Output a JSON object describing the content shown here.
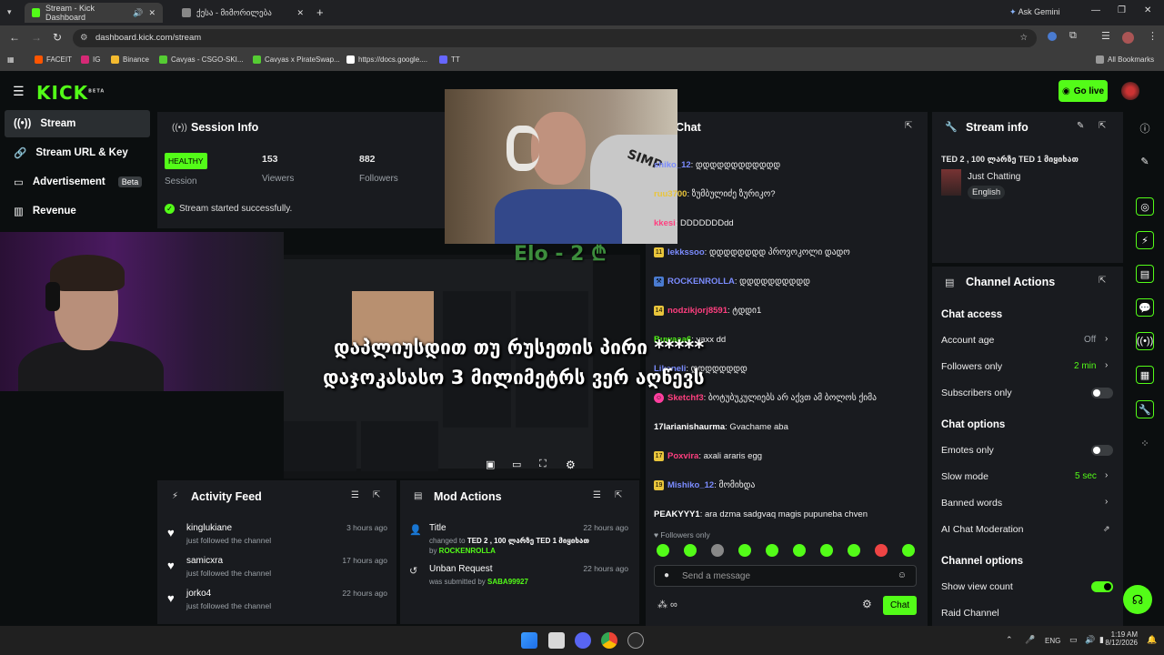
{
  "browser": {
    "tabs": [
      {
        "title": "Stream - Kick Dashboard",
        "active": true
      },
      {
        "title": "ქესა - მიმორილება",
        "active": false
      }
    ],
    "ask_gemini": "Ask Gemini",
    "url": "dashboard.kick.com/stream",
    "bookmarks": [
      "FACEIT",
      "IG",
      "Binance",
      "Cavyas - CSGO-SKI...",
      "Cavyas x PirateSwap...",
      "https://docs.google....",
      "TT"
    ],
    "all_bookmarks": "All Bookmarks"
  },
  "app": {
    "logo": "KICK",
    "logo_beta": "BETA",
    "go_live": "Go live",
    "sidebar": [
      {
        "label": "Stream",
        "icon": "broadcast-icon",
        "active": true
      },
      {
        "label": "Stream URL & Key",
        "icon": "link-icon"
      },
      {
        "label": "Advertisement",
        "icon": "monitor-icon",
        "badge": "Beta"
      },
      {
        "label": "Revenue",
        "icon": "bar-chart-icon"
      }
    ]
  },
  "session": {
    "title": "Session Info",
    "health": "HEALTHY",
    "health_label": "Session",
    "viewers": "153",
    "viewers_label": "Viewers",
    "followers": "882",
    "followers_label": "Followers",
    "status": "Stream started successfully."
  },
  "overlay": {
    "elo": "Elo - 2 ₾",
    "subtitle_line1": "დაპლიუსდით თუ რუსეთის პირი *****",
    "subtitle_line2": "დაჯოკასასო 3 მილიმეტრს ვერ აღწევს"
  },
  "chat": {
    "title": "Chat",
    "messages": [
      {
        "user": "shiko_12",
        "text": ": დდდდდდდდდდდდ",
        "color": "#7b8cff",
        "badge": ""
      },
      {
        "user": "ruu3700",
        "text": ": ზუმბულიძე ზურიკო?",
        "color": "#e9c53b",
        "badge": ""
      },
      {
        "user": "kkesi",
        "text": ": DDDDDDDdd",
        "color": "#ff3f7f",
        "badge": ""
      },
      {
        "user": "lekkssoo",
        "text": ": დდდდდდდდ პროვოკოლი დადო",
        "color": "#7b8cff",
        "badge": "11"
      },
      {
        "user": "ROCKENROLLA",
        "text": ": დდდდდდდდდდ",
        "color": "#7b8cff",
        "badge": "rock"
      },
      {
        "user": "nodzikjorj8591",
        "text": ": ტდდი1",
        "color": "#ff3f7f",
        "badge": "14"
      },
      {
        "user": "Buwaaa6",
        "text": ": vaxx dd",
        "color": "#53fc18",
        "badge": ""
      },
      {
        "user": "Likaneli",
        "text": ": დდდდდდდდ",
        "color": "#7b8cff",
        "badge": ""
      },
      {
        "user": "Sketchf3",
        "text": ": ბოტუბუკულიებს არ აქვთ ამ ბოლოს ქიმა",
        "color": "#ff3f7f",
        "badge": "pink"
      },
      {
        "user": "17larianishaurma",
        "text": ": Gvachame aba",
        "color": "#ffffff",
        "badge": ""
      },
      {
        "user": "Poxvira",
        "text": ": axali araris egg",
        "color": "#ff3f7f",
        "badge": "17"
      },
      {
        "user": "Mishiko_12",
        "text": ": მომიხდა",
        "color": "#7b8cff",
        "badge": "19"
      },
      {
        "user": "PEAKYYY1",
        "text": ": ara dzma sadgvaq magis pupuneba chven",
        "color": "#ffffff",
        "badge": ""
      }
    ],
    "followers_only": "Followers only",
    "placeholder": "Send a message",
    "send_label": "Chat"
  },
  "stream_info": {
    "title": "Stream info",
    "stream_title": "TED 2 , 100 ლარზე TED 1 მიყიხათ",
    "category": "Just Chatting",
    "language": "English"
  },
  "channel_actions": {
    "title": "Channel Actions",
    "chat_access": "Chat access",
    "account_age": "Account age",
    "account_age_val": "Off",
    "followers_only": "Followers only",
    "followers_only_val": "2 min",
    "subscribers_only": "Subscribers only",
    "chat_options": "Chat options",
    "emotes_only": "Emotes only",
    "slow_mode": "Slow mode",
    "slow_mode_val": "5 sec",
    "banned_words": "Banned words",
    "ai_moderation": "AI Chat Moderation",
    "channel_options": "Channel options",
    "show_view_count": "Show view count",
    "raid_channel": "Raid Channel"
  },
  "activity": {
    "title": "Activity Feed",
    "items": [
      {
        "name": "kinglukiane",
        "action": "just followed the channel",
        "time": "3 hours ago"
      },
      {
        "name": "samicxra",
        "action": "just followed the channel",
        "time": "17 hours ago"
      },
      {
        "name": "jorko4",
        "action": "just followed the channel",
        "time": "22 hours ago"
      }
    ]
  },
  "mod_actions": {
    "title": "Mod Actions",
    "items": [
      {
        "title": "Title",
        "pre": "changed to ",
        "value": "TED 2 , 100 ლარზე TED 1 მიყიხათ",
        "mid": " by ",
        "who": "ROCKENROLLA",
        "time": "22 hours ago"
      },
      {
        "title": "Unban Request",
        "pre": "was submitted by ",
        "value": "",
        "mid": "",
        "who": "SABA99927",
        "time": "22 hours ago"
      }
    ]
  },
  "taskbar": {
    "lang": "ENG",
    "time": "1:19 AM",
    "date": "8/12/2026"
  }
}
